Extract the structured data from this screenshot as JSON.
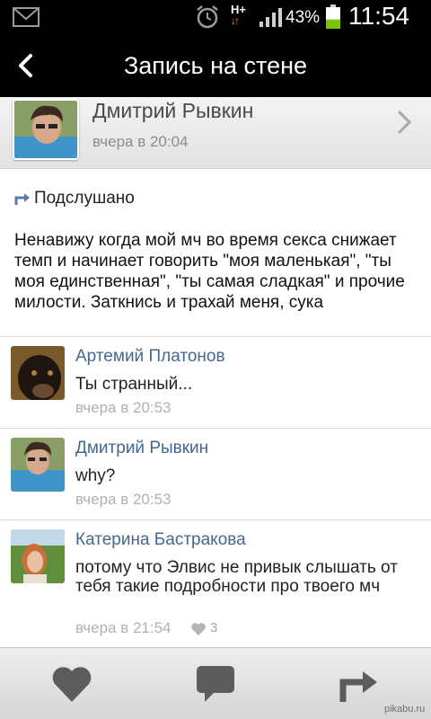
{
  "status_bar": {
    "network": "H+",
    "battery_percent": "43%",
    "time": "11:54",
    "battery_level": 0.43,
    "icons": [
      "mail-icon",
      "alarm-icon",
      "signal-icon",
      "battery-icon"
    ]
  },
  "header": {
    "title": "Запись на стене",
    "back_icon": "chevron-left-icon"
  },
  "author": {
    "name": "Дмитрий Рывкин",
    "time": "вчера в 20:04"
  },
  "post": {
    "source": "Подслушано",
    "text": "Ненавижу когда мой мч во время секса снижает темп и начинает говорить \"моя маленькая\", \"ты моя единственная\", \"ты самая сладкая\" и прочие милости. Заткнись и трахай меня, сука"
  },
  "comments": [
    {
      "name": "Артемий Платонов",
      "text": "Ты странный...",
      "time": "вчера в 20:53"
    },
    {
      "name": "Дмитрий Рывкин",
      "text": "why?",
      "time": "вчера в 20:53"
    },
    {
      "name": "Катерина Бастракова",
      "text": "потому что Элвис не привык слышать от тебя такие подробности про твоего мч",
      "time": "вчера в 21:54",
      "likes": "3"
    }
  ],
  "bottom_bar": {
    "buttons": [
      "heart-icon",
      "comment-icon",
      "share-icon"
    ]
  },
  "watermark": "pikabu.ru",
  "colors": {
    "name_link": "#45688e",
    "timestamp": "#b0b0b0",
    "header_bg": "#000000"
  }
}
